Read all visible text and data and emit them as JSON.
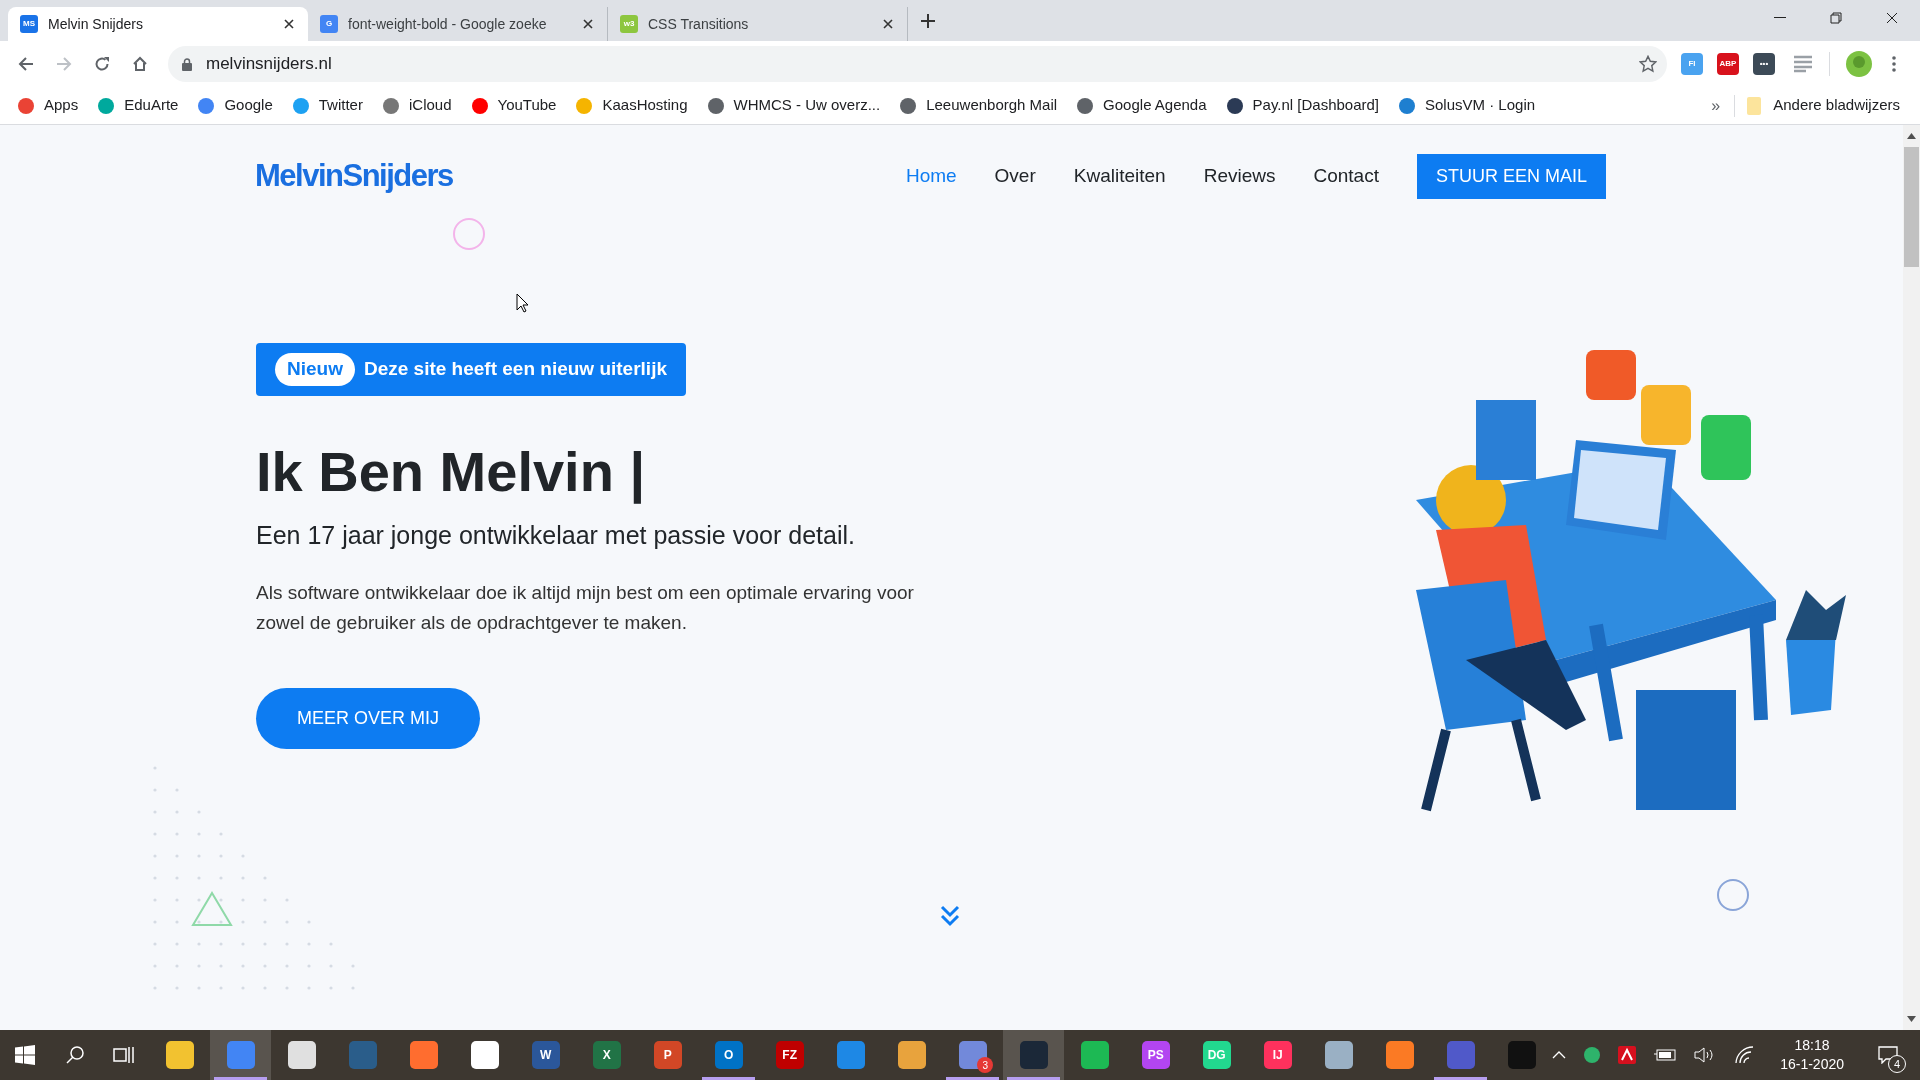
{
  "browser": {
    "tabs": [
      {
        "title": "Melvin Snijders",
        "favicon": "MS",
        "color": "#1a73e8",
        "selected": true
      },
      {
        "title": "font-weight-bold - Google zoeke",
        "favicon": "G",
        "color": "#4285f4",
        "selected": false
      },
      {
        "title": "CSS Transitions",
        "favicon": "w3",
        "color": "#8dc63f",
        "selected": false
      }
    ],
    "url": "melvinsnijders.nl",
    "bookmarks": [
      {
        "label": "Apps",
        "color": "#ea4335"
      },
      {
        "label": "EduArte",
        "color": "#00a99d"
      },
      {
        "label": "Google",
        "color": "#4285f4"
      },
      {
        "label": "Twitter",
        "color": "#1da1f2"
      },
      {
        "label": "iCloud",
        "color": "#777777"
      },
      {
        "label": "YouTube",
        "color": "#ff0000"
      },
      {
        "label": "KaasHosting",
        "color": "#f5b400"
      },
      {
        "label": "WHMCS - Uw overz...",
        "color": "#5f6368"
      },
      {
        "label": "Leeuwenborgh Mail",
        "color": "#5f6368"
      },
      {
        "label": "Google Agenda",
        "color": "#5f6368"
      },
      {
        "label": "Pay.nl [Dashboard]",
        "color": "#2b3a55"
      },
      {
        "label": "SolusVM · Login",
        "color": "#1e7fd0"
      }
    ],
    "more_bookmarks": "»",
    "other_bookmarks": "Andere bladwijzers",
    "extensions": [
      {
        "label": "FI",
        "color": "#4aa3f0"
      },
      {
        "label": "ABP",
        "color": "#d8121c"
      },
      {
        "label": "•••",
        "color": "#3c4a57"
      }
    ]
  },
  "site": {
    "logo": "MelvinSnijders",
    "nav": [
      {
        "label": "Home",
        "selected": true
      },
      {
        "label": "Over",
        "selected": false
      },
      {
        "label": "Kwaliteiten",
        "selected": false
      },
      {
        "label": "Reviews",
        "selected": false
      },
      {
        "label": "Contact",
        "selected": false
      }
    ],
    "cta": "STUUR EEN MAIL",
    "announcement": {
      "badge": "Nieuw",
      "text": "Deze site heeft een nieuw uiterlijk"
    },
    "heading": "Ik Ben Melvin |",
    "subtitle": "Een 17 jaar jonge ontwikkelaar met passie voor detail.",
    "paragraph": "Als software ontwikkelaar doe ik altijd mijn best om een optimale ervaring voor zowel de gebruiker als de opdrachtgever te maken.",
    "button": "MEER OVER MIJ"
  },
  "taskbar": {
    "apps": [
      {
        "color": "#f2c230",
        "running": false,
        "selected": false
      },
      {
        "color": "#4285f4",
        "running": true,
        "selected": true
      },
      {
        "color": "#e0e0e0",
        "running": false,
        "selected": false
      },
      {
        "color": "#2a5d8a",
        "running": false,
        "selected": false
      },
      {
        "color": "#ff6d2f",
        "running": false,
        "selected": false
      },
      {
        "color": "#ffffff",
        "running": false,
        "selected": false
      },
      {
        "color": "#2b579a",
        "label": "W",
        "running": false,
        "selected": false
      },
      {
        "color": "#217346",
        "label": "X",
        "running": false,
        "selected": false
      },
      {
        "color": "#d24726",
        "label": "P",
        "running": false,
        "selected": false
      },
      {
        "color": "#0072c6",
        "label": "O",
        "running": true,
        "selected": false
      },
      {
        "color": "#bf0000",
        "label": "FZ",
        "running": false,
        "selected": false
      },
      {
        "color": "#1e88e5",
        "running": false,
        "selected": false
      },
      {
        "color": "#e8a33d",
        "running": false,
        "selected": false
      },
      {
        "color": "#7289da",
        "running": true,
        "selected": false,
        "badge": "3"
      },
      {
        "color": "#1b2838",
        "running": true,
        "selected": true
      },
      {
        "color": "#1db954",
        "running": false,
        "selected": false
      },
      {
        "color": "#b345f1",
        "label": "PS",
        "running": false,
        "selected": false
      },
      {
        "color": "#22d88f",
        "label": "DG",
        "running": false,
        "selected": false
      },
      {
        "color": "#fe315d",
        "label": "IJ",
        "running": false,
        "selected": false
      },
      {
        "color": "#9ab0c4",
        "running": false,
        "selected": false
      },
      {
        "color": "#fb7a24",
        "running": false,
        "selected": false
      },
      {
        "color": "#5059c9",
        "running": true,
        "selected": false
      },
      {
        "color": "#111111",
        "running": false,
        "selected": false
      }
    ],
    "time": "18:18",
    "date": "16-1-2020",
    "notifications": "4"
  }
}
